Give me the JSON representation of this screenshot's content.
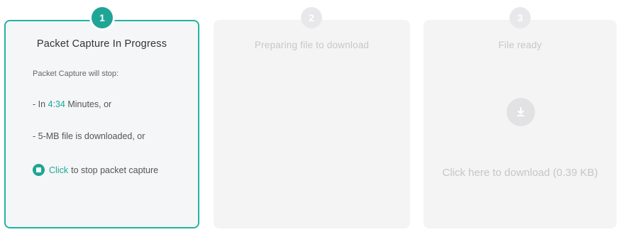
{
  "steps": [
    {
      "number": "1",
      "title": "Packet Capture In Progress",
      "intro": "Packet Capture will stop:",
      "condition_time_prefix": "- In ",
      "condition_time_value": "4:34",
      "condition_time_suffix": " Minutes, or",
      "condition_size": "- 5-MB file is downloaded, or",
      "stop_link_label": "Click",
      "stop_text": "to stop packet capture"
    },
    {
      "number": "2",
      "title": "Preparing file to download"
    },
    {
      "number": "3",
      "title": "File ready",
      "download_label": "Click here to download (0.39 KB)",
      "download_icon": "download-icon"
    }
  ],
  "colors": {
    "accent": "#1fa596",
    "inactive_text": "#c7c7c9",
    "card_bg": "#f4f4f5"
  }
}
